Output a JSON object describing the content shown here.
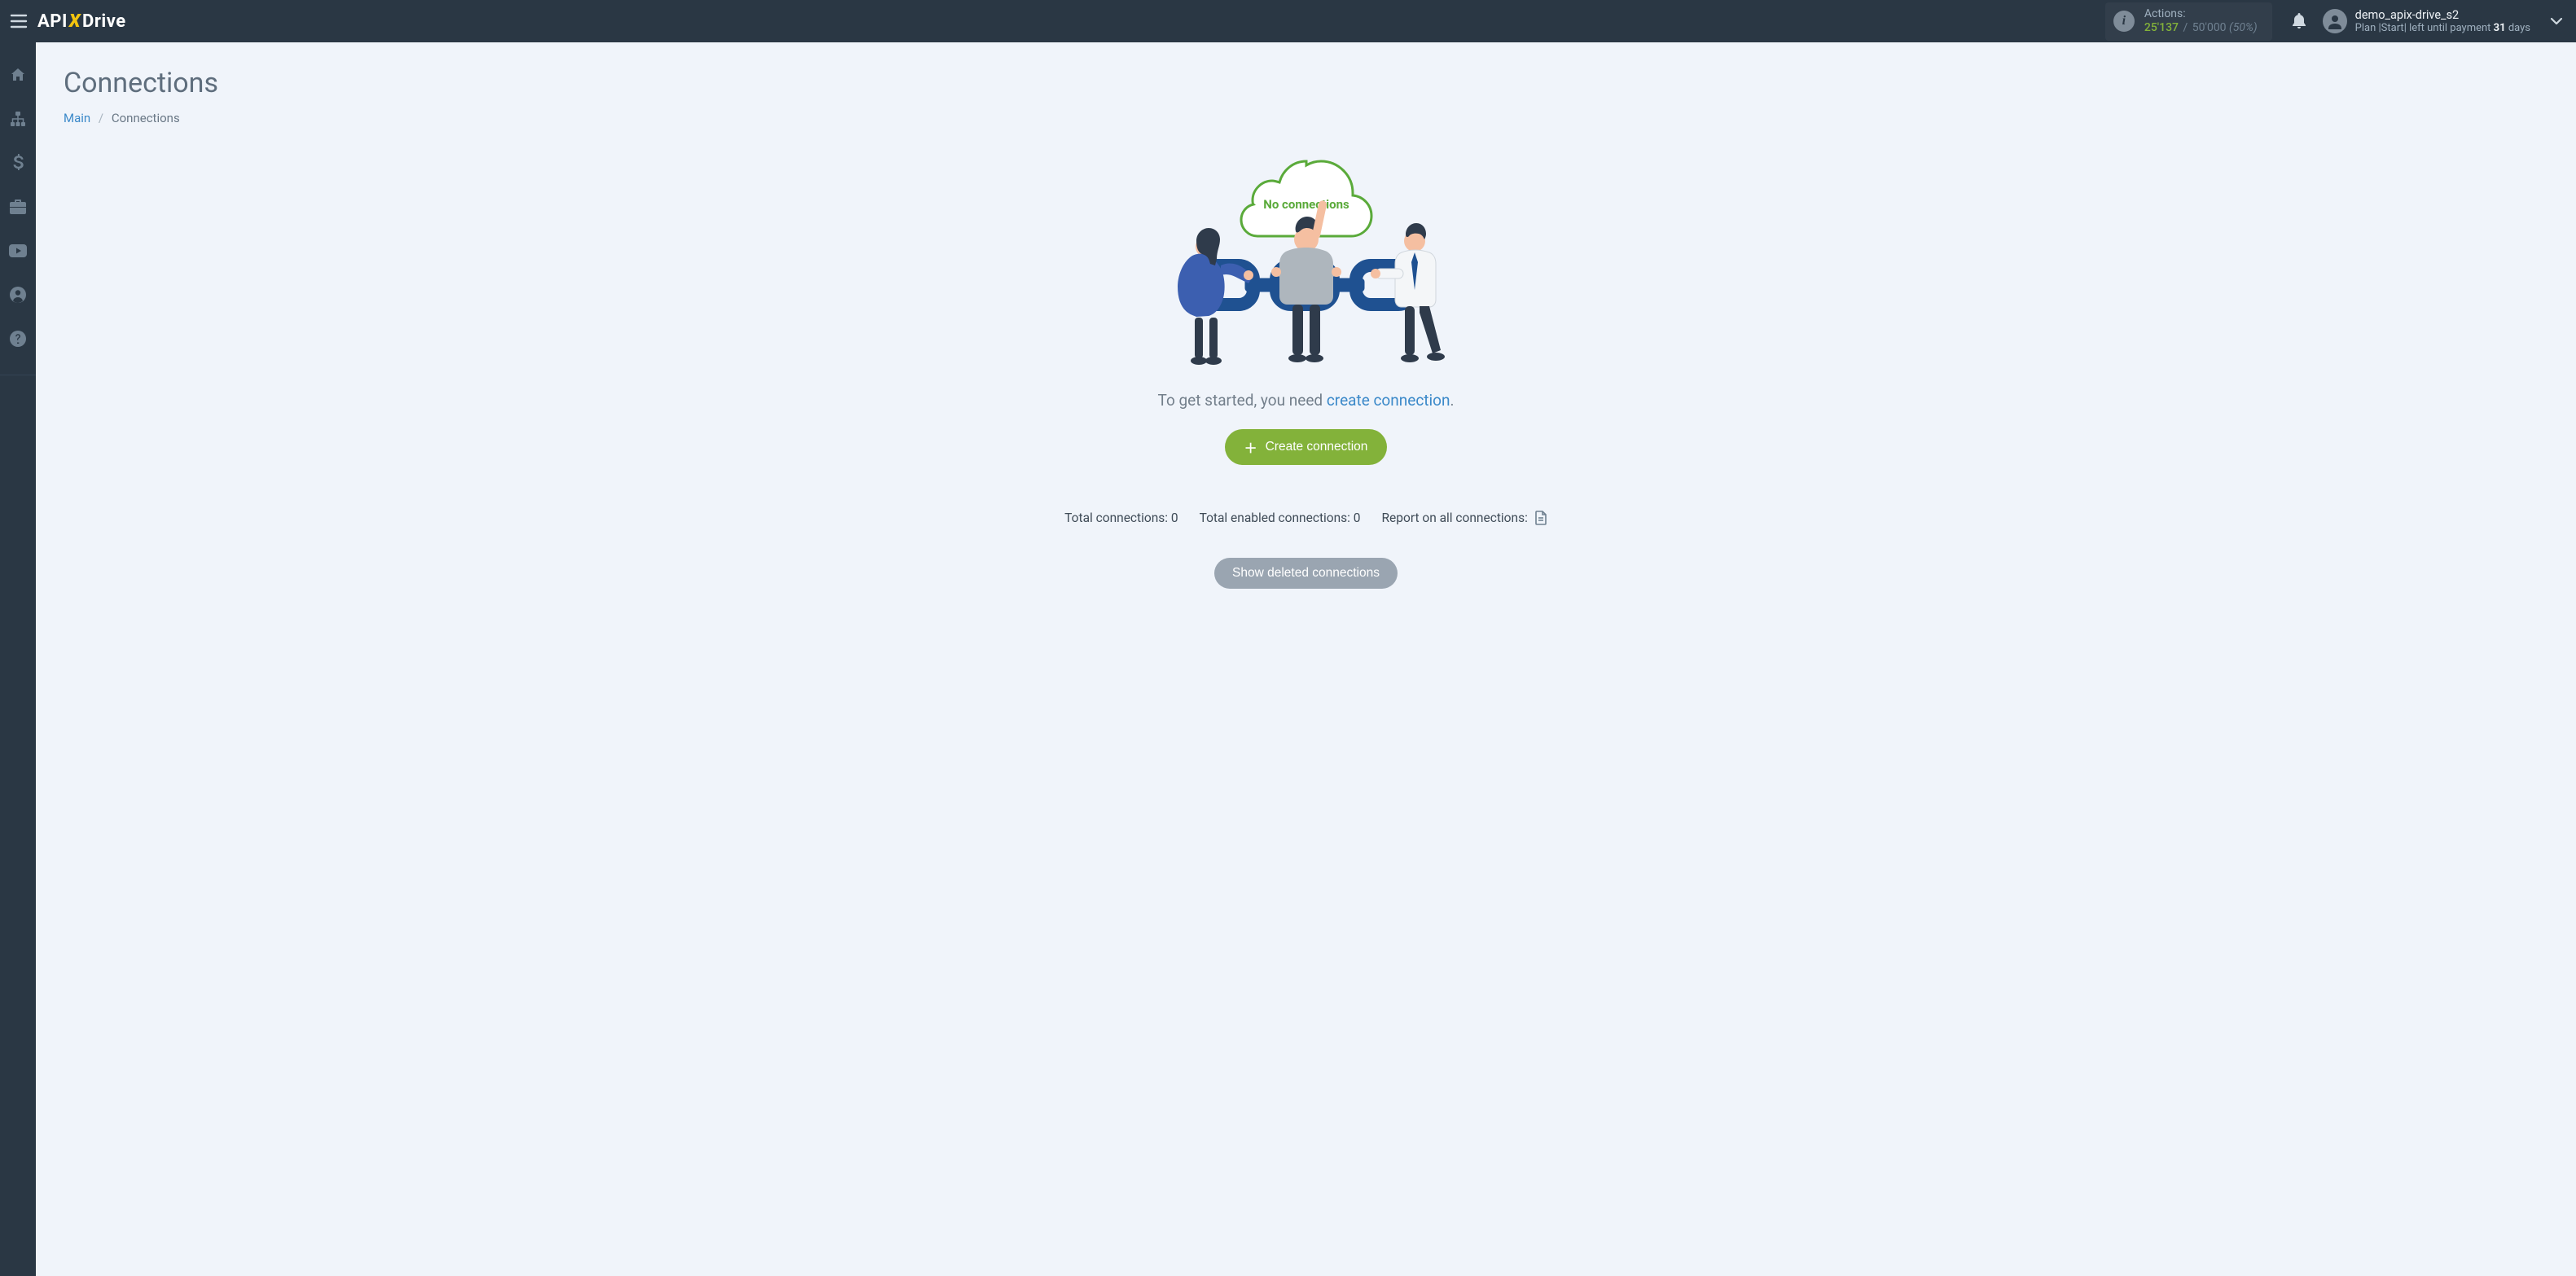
{
  "header": {
    "logo": {
      "part1": "API",
      "part2": "X",
      "part3": "Drive"
    },
    "actions": {
      "label": "Actions:",
      "used": "25'137",
      "separator": "/",
      "limit": "50'000",
      "percent": "(50%)"
    },
    "user": {
      "name": "demo_apix-drive_s2",
      "plan_prefix": "Plan |",
      "plan_name": "Start",
      "plan_mid": "| left until payment ",
      "days": "31",
      "plan_suffix": " days"
    }
  },
  "sidebar": {
    "items": [
      {
        "name": "home"
      },
      {
        "name": "connections"
      },
      {
        "name": "billing"
      },
      {
        "name": "briefcase"
      },
      {
        "name": "youtube"
      },
      {
        "name": "account"
      },
      {
        "name": "help"
      }
    ]
  },
  "page": {
    "title": "Connections",
    "breadcrumb": {
      "root": "Main",
      "separator": "/",
      "current": "Connections"
    },
    "cloud_label": "No connections",
    "get_started_prefix": "To get started, you need ",
    "get_started_link": "create connection",
    "get_started_suffix": ".",
    "create_button": "Create connection",
    "stats": {
      "total_label": "Total connections: ",
      "total_value": "0",
      "enabled_label": "Total enabled connections: ",
      "enabled_value": "0",
      "report_label": "Report on all connections: "
    },
    "show_deleted": "Show deleted connections"
  }
}
